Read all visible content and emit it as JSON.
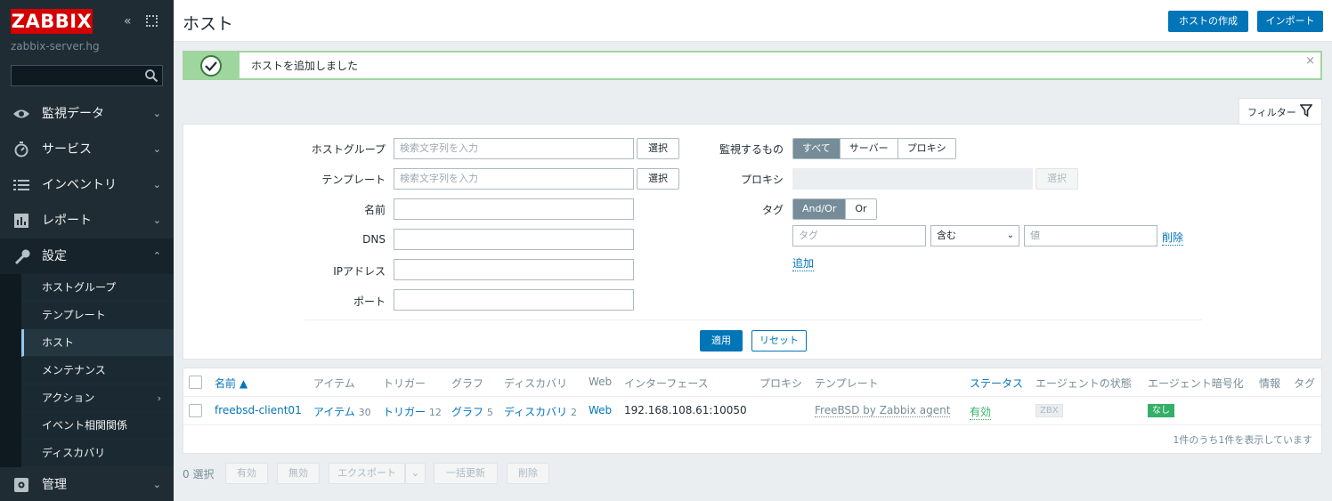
{
  "sidebar": {
    "brand": "ZABBIX",
    "server_name": "zabbix-server.hg",
    "search_value": "",
    "menu": [
      {
        "label": "監視データ",
        "icon": "eye-icon"
      },
      {
        "label": "サービス",
        "icon": "clock-icon"
      },
      {
        "label": "インベントリ",
        "icon": "list-icon"
      },
      {
        "label": "レポート",
        "icon": "report-icon"
      },
      {
        "label": "設定",
        "icon": "wrench-icon"
      },
      {
        "label": "管理",
        "icon": "gear-icon"
      }
    ],
    "submenu": [
      {
        "label": "ホストグループ"
      },
      {
        "label": "テンプレート"
      },
      {
        "label": "ホスト"
      },
      {
        "label": "メンテナンス"
      },
      {
        "label": "アクション"
      },
      {
        "label": "イベント相関関係"
      },
      {
        "label": "ディスカバリ"
      }
    ]
  },
  "header": {
    "title": "ホスト",
    "create_label": "ホストの作成",
    "import_label": "インポート"
  },
  "message": {
    "text": "ホストを追加しました",
    "close": "×"
  },
  "filter": {
    "tab_label": "フィルター",
    "hostgroup_label": "ホストグループ",
    "template_label": "テンプレート",
    "name_label": "名前",
    "dns_label": "DNS",
    "ip_label": "IPアドレス",
    "port_label": "ポート",
    "search_placeholder": "検索文字列を入力",
    "select_label": "選択",
    "monitored_label": "監視するもの",
    "monitored_options": [
      "すべて",
      "サーバー",
      "プロキシ"
    ],
    "proxy_label": "プロキシ",
    "tag_label": "タグ",
    "tag_ops": [
      "And/Or",
      "Or"
    ],
    "tag_placeholder": "タグ",
    "tag_operator": "含む",
    "value_placeholder": "値",
    "remove_label": "削除",
    "add_label": "追加",
    "apply_label": "適用",
    "reset_label": "リセット"
  },
  "table": {
    "headers": {
      "name": "名前 ▲",
      "items": "アイテム",
      "triggers": "トリガー",
      "graphs": "グラフ",
      "discovery": "ディスカバリ",
      "web": "Web",
      "interface": "インターフェース",
      "proxy": "プロキシ",
      "templates": "テンプレート",
      "status": "ステータス",
      "agent_status": "エージェントの状態",
      "agent_encryption": "エージェント暗号化",
      "info": "情報",
      "tags": "タグ"
    },
    "row": {
      "name": "freebsd-client01",
      "items": "アイテム",
      "items_count": "30",
      "triggers": "トリガー",
      "triggers_count": "12",
      "graphs": "グラフ",
      "graphs_count": "5",
      "discovery": "ディスカバリ",
      "discovery_count": "2",
      "web": "Web",
      "interface": "192.168.108.61:10050",
      "template": "FreeBSD by Zabbix agent",
      "status": "有効",
      "agent_badge": "ZBX",
      "encryption": "なし"
    },
    "footer": "1件のうち1件を表示しています"
  },
  "bottom": {
    "selected": "0 選択",
    "enable": "有効",
    "disable": "無効",
    "export": "エクスポート",
    "mass_update": "一括更新",
    "delete": "削除"
  },
  "colors": {
    "accent": "#0275b8",
    "brand": "#d40000",
    "status_ok": "#34af67"
  }
}
